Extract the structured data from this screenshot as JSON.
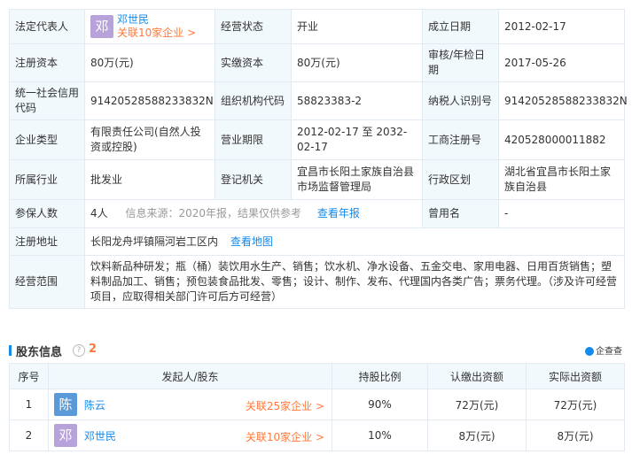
{
  "info": {
    "legal_rep_label": "法定代表人",
    "legal_rep_avatar": "邓",
    "legal_rep_name": "邓世民",
    "legal_rep_link": "关联10家企业 >",
    "status_label": "经营状态",
    "status_value": "开业",
    "est_date_label": "成立日期",
    "est_date_value": "2012-02-17",
    "reg_capital_label": "注册资本",
    "reg_capital_value": "80万(元)",
    "paid_capital_label": "实缴资本",
    "paid_capital_value": "80万(元)",
    "approve_date_label": "审核/年检日期",
    "approve_date_value": "2017-05-26",
    "credit_code_label": "统一社会信用代码",
    "credit_code_value": "91420528588233832N",
    "org_code_label": "组织机构代码",
    "org_code_value": "58823383-2",
    "taxpayer_label": "纳税人识别号",
    "taxpayer_value": "91420528588233832N",
    "company_type_label": "企业类型",
    "company_type_value": "有限责任公司(自然人投资或控股)",
    "term_label": "营业期限",
    "term_value": "2012-02-17 至 2032-02-17",
    "reg_no_label": "工商注册号",
    "reg_no_value": "420528000011882",
    "industry_label": "所属行业",
    "industry_value": "批发业",
    "authority_label": "登记机关",
    "authority_value": "宜昌市长阳土家族自治县市场监督管理局",
    "region_label": "行政区划",
    "region_value": "湖北省宜昌市长阳土家族自治县",
    "insured_label": "参保人数",
    "insured_value": "4人",
    "insured_source": "信息来源：2020年报，结果仅供参考",
    "insured_link": "查看年报",
    "former_name_label": "曾用名",
    "former_name_value": "-",
    "address_label": "注册地址",
    "address_value": "长阳龙舟坪镇隔河岩工区内",
    "address_link": "查看地图",
    "scope_label": "经营范围",
    "scope_value": "饮料新品种研发；瓶（桶）装饮用水生产、销售；饮水机、净水设备、五金交电、家用电器、日用百货销售；塑料制品加工、销售；预包装食品批发、零售；设计、制作、发布、代理国内各类广告；票务代理。（涉及许可经营项目，应取得相关部门许可后方可经营）"
  },
  "shareholders": {
    "title": "股东信息",
    "help_icon": "?",
    "count": "2",
    "logo_text": "企查查",
    "headers": [
      "序号",
      "发起人/股东",
      "持股比例",
      "认缴出资额",
      "实际出资额"
    ],
    "rows": [
      {
        "idx": "1",
        "avatar": "陈",
        "avatar_color": "#5b9ad8",
        "name": "陈云",
        "link": "关联25家企业 >",
        "ratio": "90%",
        "subscribed": "72万(元)",
        "actual": "72万(元)"
      },
      {
        "idx": "2",
        "avatar": "邓",
        "avatar_color": "#b7a3d9",
        "name": "邓世民",
        "link": "关联10家企业 >",
        "ratio": "10%",
        "subscribed": "8万(元)",
        "actual": "8万(元)"
      }
    ]
  },
  "colors": {
    "accent": "#128bed",
    "link_orange": "#fd7a3a",
    "label_bg": "#f2f9fc",
    "avatar_deng": "#b7a3d9"
  }
}
